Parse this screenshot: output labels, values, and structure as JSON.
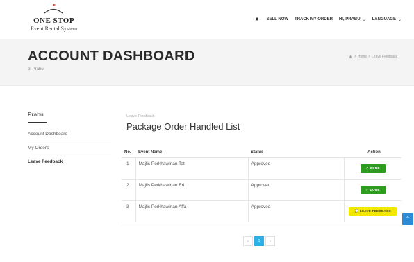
{
  "header": {
    "logo_line1": "ONE STOP",
    "logo_line2": "Event Rental System",
    "nav": {
      "sell_now": "SELL NOW",
      "track_order": "TRACK MY ORDER",
      "user": "HI, PRABU",
      "language": "LANGUAGE"
    }
  },
  "banner": {
    "title": "ACCOUNT DASHBOARD",
    "subtitle": "of Prabu.",
    "breadcrumb": {
      "home": "Home",
      "current": "Leave Feedback",
      "separator": ">"
    }
  },
  "sidebar": {
    "title": "Prabu",
    "items": [
      {
        "label": "Account Dashboard"
      },
      {
        "label": "My Orders"
      },
      {
        "label": "Leave Feedback"
      }
    ]
  },
  "main": {
    "eyebrow": "Leave Feedback",
    "title": "Package Order Handled List",
    "table": {
      "headers": {
        "no": "No.",
        "event": "Event Name",
        "status": "Status",
        "action": "Action"
      },
      "rows": [
        {
          "no": "1",
          "event": "Majlis Perkhawinan Tat",
          "status": "Approved",
          "action": "DONE"
        },
        {
          "no": "2",
          "event": "Majlis Perkhawinan Eri",
          "status": "Approved",
          "action": "DONE"
        },
        {
          "no": "3",
          "event": "Majlis Perkhawinan Affa",
          "status": "Approved",
          "action": "LEAVE FEEDBACK"
        }
      ]
    }
  },
  "pagination": {
    "prev": "«",
    "current": "1",
    "next": "»"
  },
  "colors": {
    "done": "#2e9c1f",
    "leave_feedback": "#f5e800",
    "active_page": "#2bb1e6",
    "back_to_top": "#2b8bd6"
  },
  "icons": {
    "home": "home-icon",
    "back_to_top": "chevron-up-icon",
    "done": "check-icon",
    "feedback": "comment-icon"
  }
}
